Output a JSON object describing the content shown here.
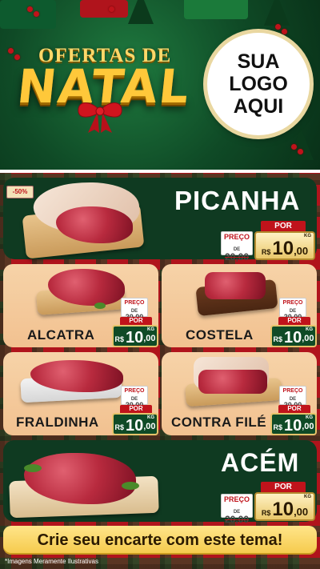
{
  "header": {
    "ofertas": "OFERTAS DE",
    "natal": "NATAL",
    "logo_lines": [
      "SUA",
      "LOGO",
      "AQUI"
    ]
  },
  "discount_badge": "-50%",
  "products": [
    {
      "name": "PICANHA",
      "preco_label": "PREÇO",
      "de_label": "DE",
      "old_price": "20,00",
      "por_label": "POR",
      "currency": "R$",
      "price_int": "10",
      "price_cents": ",00",
      "unit": "KG"
    },
    {
      "name": "ALCATRA",
      "preco_label": "PREÇO",
      "de_label": "DE",
      "old_price": "20,00",
      "por_label": "POR",
      "currency": "R$",
      "price_int": "10",
      "price_cents": ",00",
      "unit": "KG"
    },
    {
      "name": "COSTELA",
      "preco_label": "PREÇO",
      "de_label": "DE",
      "old_price": "20,00",
      "por_label": "POR",
      "currency": "R$",
      "price_int": "10",
      "price_cents": ",00",
      "unit": "KG"
    },
    {
      "name": "FRALDINHA",
      "preco_label": "PREÇO",
      "de_label": "DE",
      "old_price": "20,00",
      "por_label": "POR",
      "currency": "R$",
      "price_int": "10",
      "price_cents": ",00",
      "unit": "KG"
    },
    {
      "name": "CONTRA FILÉ",
      "preco_label": "PREÇO",
      "de_label": "DE",
      "old_price": "20,00",
      "por_label": "POR",
      "currency": "R$",
      "price_int": "10",
      "price_cents": ",00",
      "unit": "KG"
    },
    {
      "name": "ACÉM",
      "preco_label": "PREÇO",
      "de_label": "DE",
      "old_price": "20,00",
      "por_label": "POR",
      "currency": "R$",
      "price_int": "10",
      "price_cents": ",00",
      "unit": "KG"
    }
  ],
  "cta": "Crie seu encarte com este tema!",
  "footnote": "*Imagens Meramente Ilustrativas",
  "colors": {
    "red": "#c0131b",
    "green": "#0f3a21",
    "gold": "#e6c36a",
    "peach": "#f6d3a8"
  }
}
